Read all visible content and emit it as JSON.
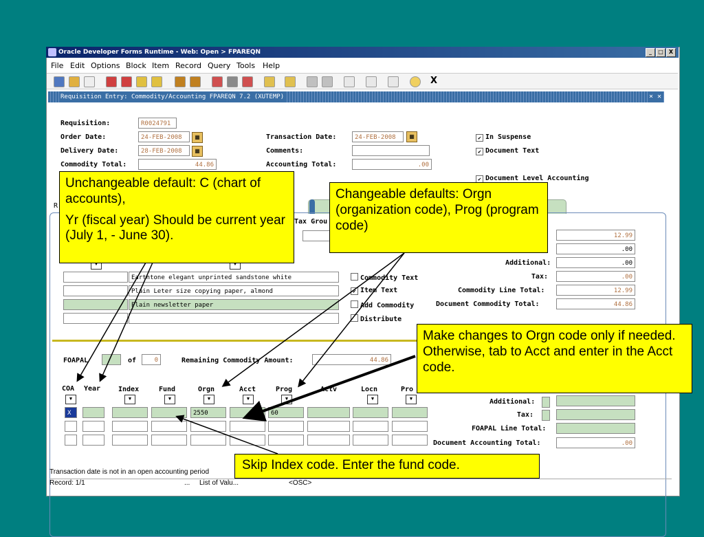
{
  "window": {
    "title": "Oracle Developer Forms Runtime - Web:  Open > FPAREQN",
    "controls": [
      "_",
      "□",
      "X"
    ]
  },
  "menu": [
    "File",
    "Edit",
    "Options",
    "Block",
    "Item",
    "Record",
    "Query",
    "Tools",
    "Help"
  ],
  "toolbar": {
    "close_glyph": "X"
  },
  "form": {
    "title": "Requisition Entry: Commodity/Accounting  FPAREQN  7.2  (XUTEMP)",
    "close_glyph": "× ✕",
    "header": {
      "requisition_label": "Requisition:",
      "requisition_value": "R0024791",
      "order_date_label": "Order Date:",
      "order_date_value": "24-FEB-2008",
      "delivery_date_label": "Delivery Date:",
      "delivery_date_value": "28-FEB-2008",
      "commodity_total_label": "Commodity Total:",
      "commodity_total_value": "44.86",
      "transaction_date_label": "Transaction Date:",
      "transaction_date_value": "24-FEB-2008",
      "comments_label": "Comments:",
      "comments_value": "",
      "accounting_total_label": "Accounting Total:",
      "accounting_total_value": ".00",
      "in_suspense_label": "In Suspense",
      "document_text_label": "Document Text",
      "doc_level_accounting_label": "Document Level Accounting"
    },
    "commodity": {
      "tab_letter": "R",
      "tax_group_label": "Tax Grou",
      "rows": [
        {
          "desc": "Earthtone elegant unprinted sandstone white"
        },
        {
          "desc": "Plain Leter size copying paper, almond"
        },
        {
          "desc": "Plain newsletter paper"
        },
        {
          "desc": ""
        }
      ],
      "commodity_text_label": "Commodity Text",
      "item_text_label": "Item Text",
      "add_commodity_label": "Add Commodity",
      "distribute_label": "Distribute",
      "amounts": {
        "val1": "12.99",
        "val2": ".00",
        "additional_label": "Additional:",
        "additional_value": ".00",
        "tax_label": "Tax:",
        "tax_value": ".00",
        "line_total_label": "Commodity Line Total:",
        "line_total_value": "12.99",
        "doc_total_label": "Document Commodity Total:",
        "doc_total_value": "44.86"
      }
    },
    "foapal": {
      "label": "FOAPAL",
      "of_label": "of",
      "of_value": "0",
      "remaining_label": "Remaining Commodity Amount:",
      "remaining_value": "44.86",
      "columns": [
        "COA",
        "Year",
        "Index",
        "Fund",
        "Orgn",
        "Acct",
        "Prog",
        "Actv",
        "Locn",
        "Pro"
      ],
      "row1": {
        "coa": "X",
        "orgn": "2550",
        "prog": "60"
      },
      "additional_label": "Additional:",
      "tax_label": "Tax:",
      "line_total_label": "FOAPAL Line Total:",
      "doc_total_label": "Document Accounting Total:",
      "doc_total_value": ".00"
    }
  },
  "status": {
    "message": "Transaction date is not in an open accounting period",
    "record": "Record: 1/1",
    "dots": "...",
    "list": "List of Valu...",
    "osc": "<OSC>"
  },
  "callouts": {
    "c1_p1": "Unchangeable default: C (chart of accounts),",
    "c1_p2": "Yr (fiscal year) Should be current year (July 1, - June 30).",
    "c2": "Changeable defaults: Orgn (organization code), Prog (program code)",
    "c3": "Make changes to Orgn code only if needed.  Otherwise, tab to Acct and enter in the Acct code.",
    "c4": "Skip Index code.  Enter the fund code."
  }
}
